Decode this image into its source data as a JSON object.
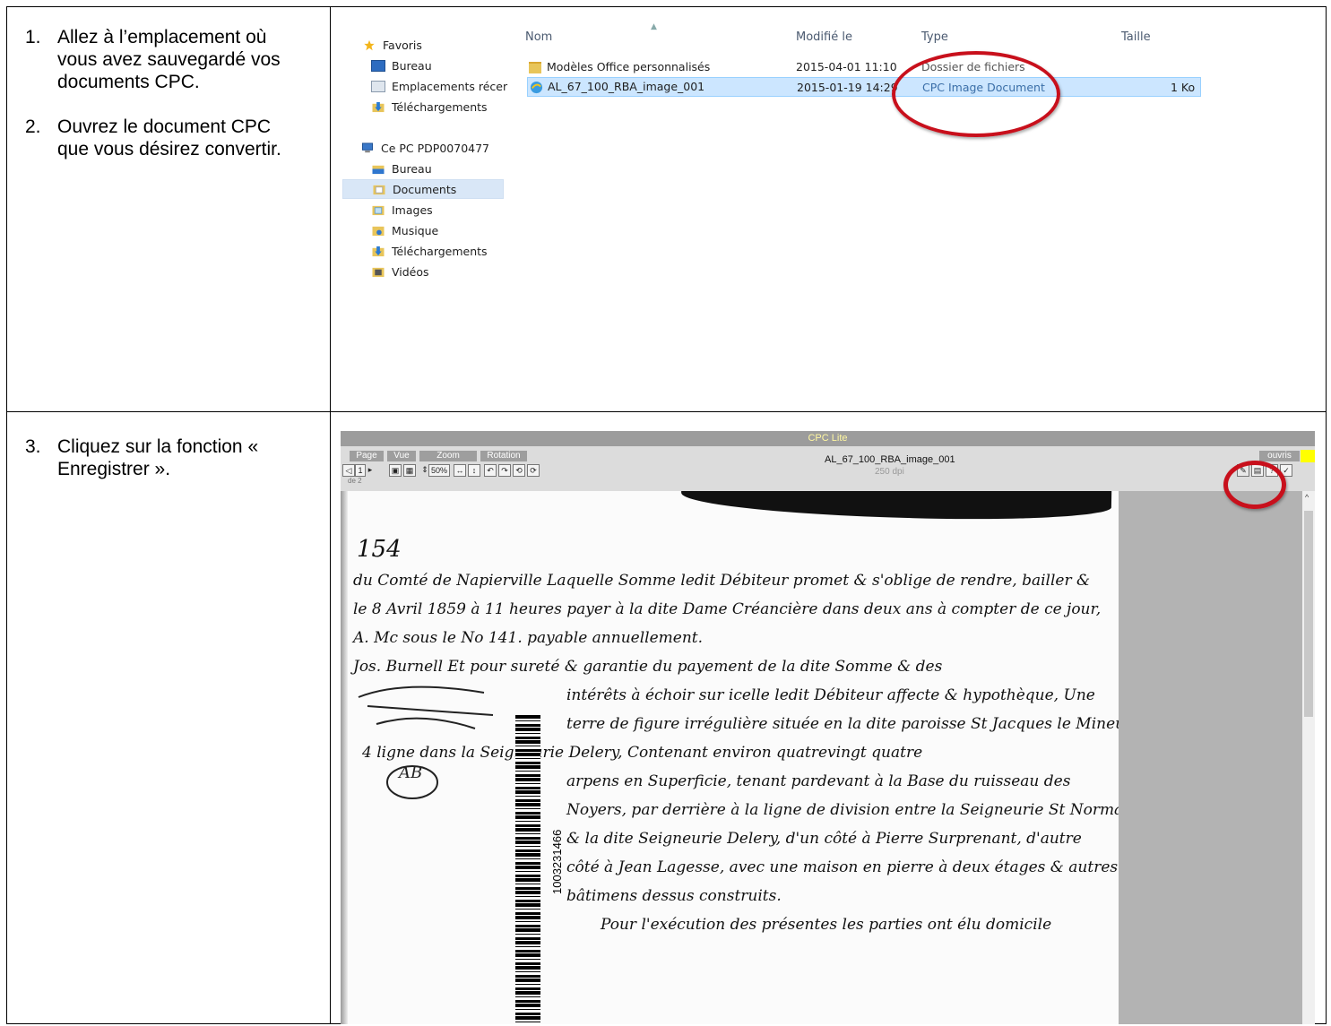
{
  "steps_top": [
    {
      "num": "1.",
      "text": "Allez à l’emplacement où vous avez sauvegardé vos documents CPC."
    },
    {
      "num": "2.",
      "text": "Ouvrez le document CPC que vous désirez convertir."
    }
  ],
  "steps_bottom": [
    {
      "num": "3.",
      "text": "Cliquez sur la fonction « Enregistrer »."
    }
  ],
  "explorer": {
    "nav": {
      "favoris": "Favoris",
      "bureau": "Bureau",
      "emplacements": "Emplacements récer",
      "telechargements": "Téléchargements",
      "ce_pc": "Ce PC PDP0070477",
      "pc_bureau": "Bureau",
      "documents": "Documents",
      "images": "Images",
      "musique": "Musique",
      "pc_telechargements": "Téléchargements",
      "videos": "Vidéos"
    },
    "columns": {
      "nom": "Nom",
      "modifie": "Modifié le",
      "type": "Type",
      "taille": "Taille"
    },
    "rows": [
      {
        "name": "Modèles Office personnalisés",
        "modified": "2015-04-01 11:10",
        "type": "Dossier de fichiers",
        "size": ""
      },
      {
        "name": "AL_67_100_RBA_image_001",
        "modified": "2015-01-19 14:29",
        "type": "CPC Image Document",
        "size": "1 Ko"
      }
    ]
  },
  "viewer": {
    "title": "CPC Lite",
    "tabs": {
      "page": "Page",
      "vue": "Vue",
      "zoom": "Zoom",
      "rotation": "Rotation"
    },
    "page_field": "1",
    "page_of": "de 2",
    "zoom_value": "50%",
    "doc_name": "AL_67_100_RBA_image_001",
    "dpi": "250 dpi",
    "right_tab": "ouvris",
    "barcode_number": "1003231466",
    "handwriting": [
      "154",
      "du Comté de Napierville Laquelle Somme ledit Débiteur promet & s'oblige de rendre, bailler &",
      "le 8 Avril 1859 à 11 heures payer à la dite Dame Créancière dans deux ans à compter de ce jour,",
      "A. Mc sous le No 141.    payable annuellement.",
      "Jos. Burnell    Et pour sureté & garantie du payement de la dite Somme & des",
      "intérêts à échoir sur icelle ledit Débiteur affecte & hypothèque, Une",
      "terre de figure irrégulière située en la dite paroisse St Jacques le Mineur",
      "4 ligne   dans la Seigneurie Delery, Contenant environ quatrevingt quatre",
      "arpens en Superficie, tenant pardevant à la Base du ruisseau des",
      "Noyers, par derrière à la ligne de division entre la Seigneurie St Normand",
      "& la dite Seigneurie Delery, d'un côté à Pierre Surprenant, d'autre",
      "côté à Jean Lagesse, avec une maison en pierre à deux étages & autres",
      "bâtimens dessus construits.",
      "Pour l'exécution des présentes les parties ont élu domicile"
    ],
    "margin_initials": "AB"
  },
  "colors": {
    "highlight_ellipse": "#c8101c",
    "selected_row": "#cce6ff"
  }
}
